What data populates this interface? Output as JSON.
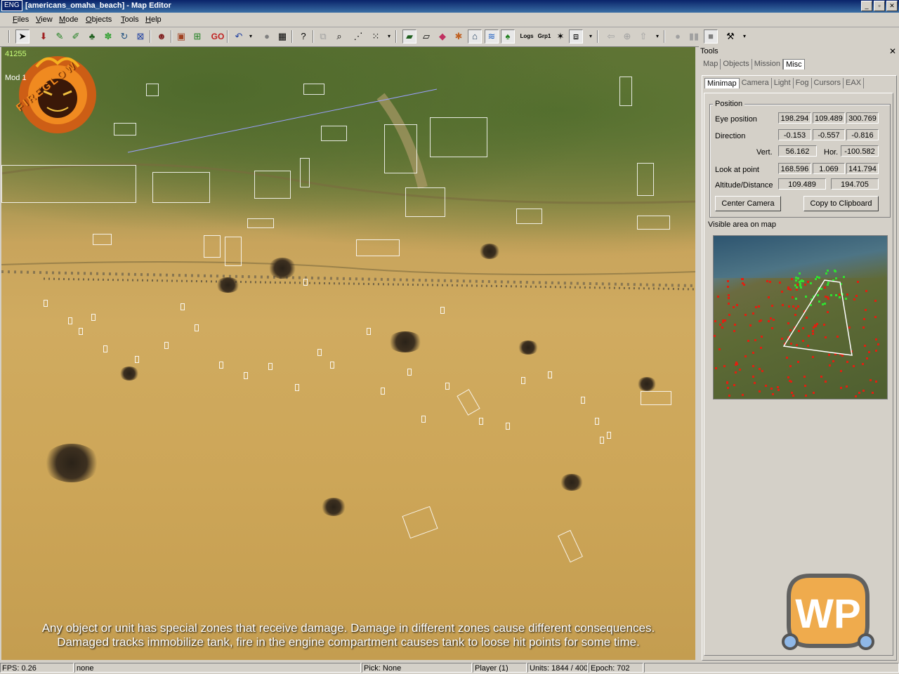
{
  "window": {
    "lang": "ENG",
    "title": "[americans_omaha_beach] - Map Editor",
    "btn_min": "_",
    "btn_max": "▫",
    "btn_close": "✕"
  },
  "menu": [
    "Files",
    "View",
    "Mode",
    "Objects",
    "Tools",
    "Help"
  ],
  "toolbar": {
    "icons": [
      "select-arrow",
      "place-object",
      "place-terrain",
      "place-brush",
      "place-forest",
      "place-grass",
      "rotate",
      "fit",
      "character",
      "load-terrain",
      "bake",
      "go",
      "undo",
      "record",
      "film",
      "help",
      "zoom",
      "path",
      "grid",
      "tile-a",
      "tile-b",
      "color",
      "palette",
      "building",
      "water",
      "tree",
      "logs",
      "group",
      "lights",
      "box",
      "left",
      "center",
      "right",
      "play",
      "pause",
      "stop",
      "hammer"
    ],
    "go_label": "GO",
    "logs_label": "Logs",
    "grp_label": "Grp1"
  },
  "viewport": {
    "hud_number": "41255",
    "hud_mode": "Mod 1",
    "logo_text": "FIREGLOW",
    "caption_line1": "Any object or unit has special zones that receive damage. Damage in different zones  cause different consequences.",
    "caption_line2": "Damaged tracks immobilize tank, fire in the engine compartment causes tank to loose hit points for some time."
  },
  "status": {
    "fps": "FPS: 0.26",
    "selection": "none",
    "pick": "Pick: None",
    "player": "Player (1)",
    "units": "Units: 1844 / 400",
    "epoch": "Epoch: 702"
  },
  "tools_panel": {
    "title": "Tools",
    "close": "✕",
    "tabs": [
      "Map",
      "Objects",
      "Mission",
      "Misc"
    ],
    "active_tab": "Misc",
    "subtabs": [
      "Minimap",
      "Camera",
      "Light",
      "Fog",
      "Cursors",
      "EAX"
    ],
    "active_subtab": "Minimap",
    "position_group": "Position",
    "eye_position_label": "Eye position",
    "eye_position": [
      "198.294",
      "109.489",
      "300.769"
    ],
    "direction_label": "Direction",
    "direction": [
      "-0.153",
      "-0.557",
      "-0.816"
    ],
    "vert_label": "Vert.",
    "vert": "56.162",
    "hor_label": "Hor.",
    "hor": "-100.582",
    "look_label": "Look at point",
    "look_at": [
      "168.596",
      "1.069",
      "141.794"
    ],
    "alt_label": "Altitude/Distance",
    "altitude": "109.489",
    "distance": "194.705",
    "center_camera": "Center Camera",
    "copy_clipboard": "Copy to Clipboard",
    "visible_area_label": "Visible area on map"
  },
  "watermark": "WP",
  "colors": {
    "titlebar": "#0a246a",
    "panel_bg": "#d4d0c8",
    "sand": "#cda658",
    "grass": "#55702f",
    "minimap_enemy": "#e02010",
    "minimap_friendly": "#30e030"
  }
}
